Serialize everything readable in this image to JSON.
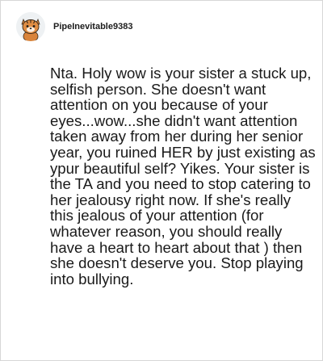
{
  "comment": {
    "author": "PipeInevitable9383",
    "avatar_icon": "snoo-tiger-avatar-icon",
    "body": "Nta. Holy wow is your sister a stuck up, selfish person. She doesn't want attention on you because of your eyes...wow...she didn't want attention taken away from her during her senior year, you ruined HER by just existing as ypur beautiful self? Yikes. Your sister is the TA and you need to stop catering to her jealousy right now. If she's really this jealous of your attention (for whatever reason, you should really have a heart to heart about that ) then she doesn't deserve you. Stop playing into bullying."
  },
  "colors": {
    "text": "#1a1a1a",
    "username": "#1c1c1c",
    "border": "#d7d7d7",
    "avatar_orange": "#d9843b"
  }
}
